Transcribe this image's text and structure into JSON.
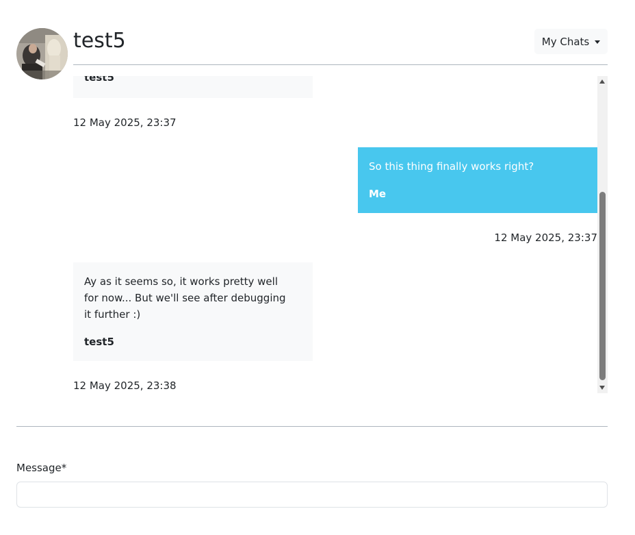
{
  "header": {
    "title": "test5",
    "my_chats_label": "My Chats"
  },
  "messages": [
    {
      "from": "them",
      "text": "",
      "sender": "test5",
      "timestamp": ""
    },
    {
      "from": "them",
      "text": "",
      "sender": "",
      "timestamp": "12 May 2025, 23:37"
    },
    {
      "from": "me",
      "text": "So this thing finally works right?",
      "sender": "Me",
      "timestamp": "12 May 2025, 23:37"
    },
    {
      "from": "them",
      "text": "Ay as it seems so, it works pretty well for now... But we'll see after debugging it further :)",
      "sender": "test5",
      "timestamp": "12 May 2025, 23:38"
    }
  ],
  "form": {
    "message_label": "Message*",
    "message_value": "",
    "message_placeholder": ""
  },
  "colors": {
    "my_bubble": "#48c7ee",
    "their_bubble": "#f8f9fa",
    "scroll_thumb": "#7d7d7d"
  },
  "icons": {
    "dropdown": "caret-down-icon",
    "scroll_up": "scroll-up-arrow-icon",
    "scroll_down": "scroll-down-arrow-icon"
  }
}
